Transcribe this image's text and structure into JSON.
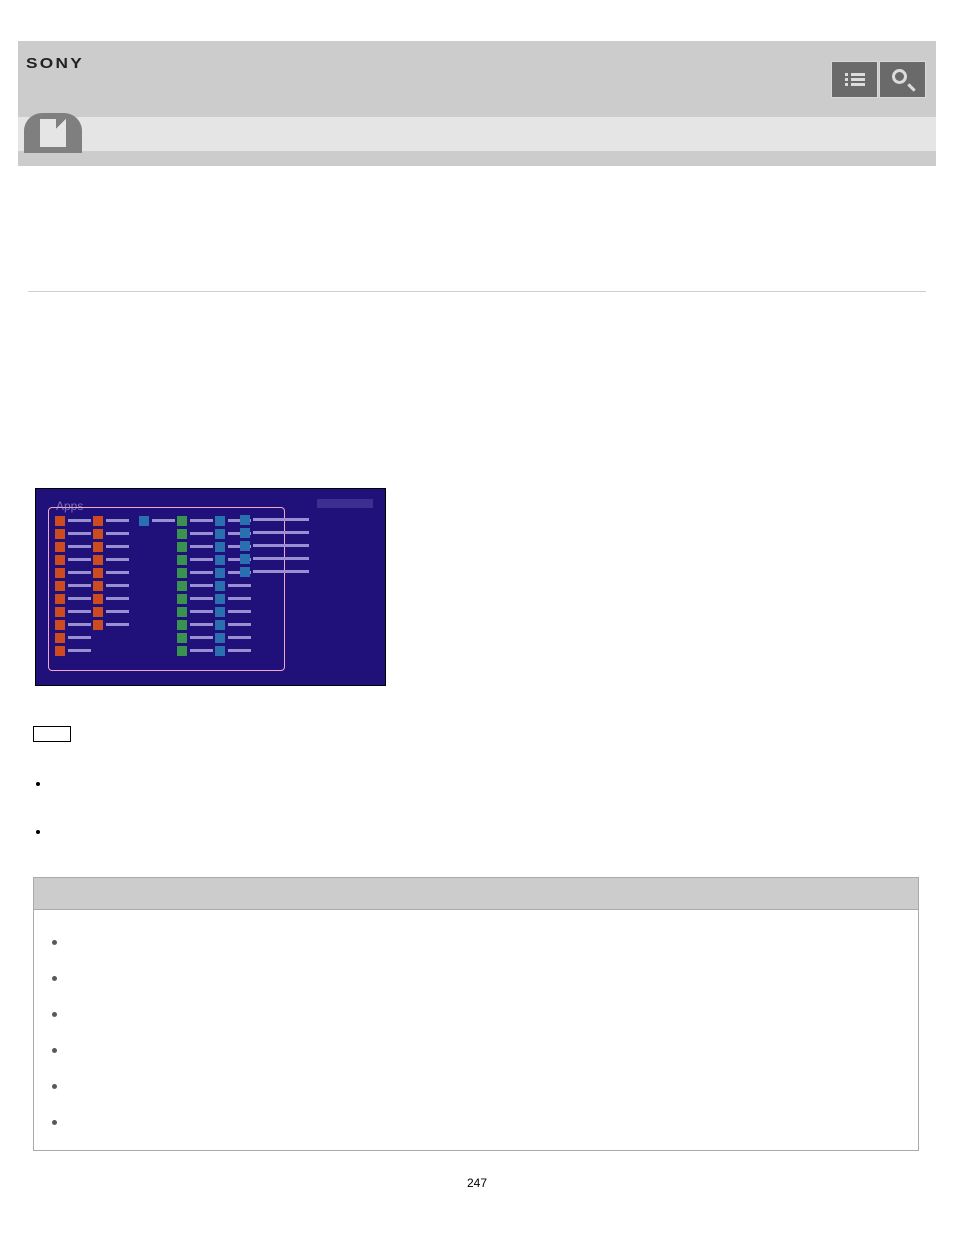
{
  "header": {
    "logo_text": "SONY"
  },
  "apps_screen": {
    "title": "Apps"
  },
  "plain_bullets": [
    "",
    ""
  ],
  "table": {
    "header": "",
    "rows": [
      "",
      "",
      "",
      "",
      "",
      ""
    ]
  },
  "page_number": "247"
}
